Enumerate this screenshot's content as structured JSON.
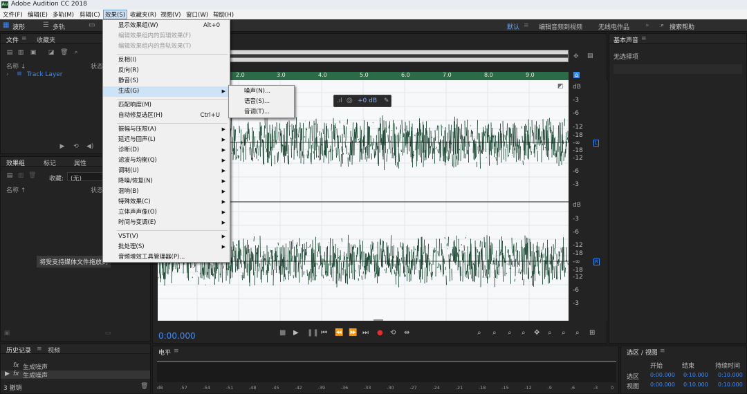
{
  "app": {
    "logo": "Au",
    "title": "Adobe Audition CC 2018"
  },
  "menubar": [
    "文件(F)",
    "编辑(E)",
    "多轨(M)",
    "剪辑(C)",
    "效果(S)",
    "收藏夹(R)",
    "视图(V)",
    "窗口(W)",
    "帮助(H)"
  ],
  "toolbar": {
    "waveform": "波形",
    "multitrack": "多轨",
    "workspace_default": "默认",
    "workspace_edit": "编辑音频到视频",
    "workspace_radio": "无线电作品",
    "search": "搜索帮助"
  },
  "effects_menu": {
    "items": [
      {
        "label": "显示效果组(W)",
        "shortcut": "Alt+0"
      },
      {
        "label": "编辑效果组内的剪辑效果(F)",
        "disabled": true
      },
      {
        "label": "编辑效果组内的音轨效果(T)",
        "disabled": true
      },
      {
        "label": "反相(I)"
      },
      {
        "label": "反向(R)"
      },
      {
        "label": "静音(S)"
      },
      {
        "label": "生成(G)",
        "submenu": true
      },
      {
        "label": "匹配响度(M)"
      },
      {
        "label": "自动修复选区(H)",
        "shortcut": "Ctrl+U"
      },
      {
        "label": "振幅与压限(A)",
        "submenu": true
      },
      {
        "label": "延迟与回声(L)",
        "submenu": true
      },
      {
        "label": "诊断(D)",
        "submenu": true
      },
      {
        "label": "滤波与均衡(Q)",
        "submenu": true
      },
      {
        "label": "调制(U)",
        "submenu": true
      },
      {
        "label": "降噪/恢复(N)",
        "submenu": true
      },
      {
        "label": "混响(B)",
        "submenu": true
      },
      {
        "label": "特殊效果(C)",
        "submenu": true
      },
      {
        "label": "立体声声像(O)",
        "submenu": true
      },
      {
        "label": "时间与变调(E)",
        "submenu": true
      },
      {
        "label": "VST(V)",
        "submenu": true
      },
      {
        "label": "批处理(S)",
        "submenu": true
      },
      {
        "label": "音频增效工具管理器(P)..."
      }
    ],
    "generate_submenu": [
      "噪声(N)...",
      "语音(S)...",
      "音调(T)..."
    ]
  },
  "files_panel": {
    "tab_files": "文件",
    "tab_favorites": "收藏夹",
    "col_name": "名称 ↓",
    "col_status": "状态",
    "file_item": "Track Layer"
  },
  "effects_rack": {
    "tab_rack": "效果组",
    "tab_markers": "标记",
    "tab_properties": "属性",
    "presets_label": "收藏:",
    "presets_value": "(无)",
    "col_name": "名称 ↑",
    "col_status": "状态",
    "drop_hint": "将受支持媒体文件拖放到"
  },
  "editor": {
    "ruler_ticks": [
      "2.0",
      "3.0",
      "4.0",
      "5.0",
      "6.0",
      "7.0",
      "8.0",
      "9.0"
    ],
    "db_unit": "dB",
    "db_top": [
      "-3",
      "-6",
      "-12",
      "-18",
      "-∞",
      "-18",
      "-12",
      "-6",
      "-3"
    ],
    "db_bottom": [
      "-3",
      "-6",
      "-12",
      "-18",
      "-∞",
      "-18",
      "-12",
      "-6",
      "-3"
    ],
    "channel_left": "L",
    "channel_right": "R",
    "hud_value": "+0 dB",
    "time": "0:00.000"
  },
  "level_panel": {
    "title": "电平",
    "scale": [
      "dB",
      "-57",
      "-54",
      "-51",
      "-48",
      "-45",
      "-42",
      "-39",
      "-36",
      "-33",
      "-30",
      "-27",
      "-24",
      "-21",
      "-18",
      "-15",
      "-12",
      "-9",
      "-6",
      "-3",
      "0"
    ]
  },
  "history_panel": {
    "tab_history": "历史记录",
    "tab_video": "视频",
    "items": [
      "生成噪声",
      "生成噪声"
    ],
    "count": "3 撤销"
  },
  "essential_sound": {
    "title": "基本声音",
    "no_selection": "无选择项"
  },
  "selection_view": {
    "title": "选区 / 视图",
    "col_start": "开始",
    "col_end": "结束",
    "col_duration": "持续时间",
    "row_selection": "选区",
    "row_view": "视图",
    "sel_start": "0:00.000",
    "sel_end": "0:10.000",
    "sel_dur": "0:10.000",
    "view_start": "0:00.000",
    "view_end": "0:10.000",
    "view_dur": "0:10.000"
  },
  "colors": {
    "accent": "#2f8bff",
    "waveform": "#1f4a36",
    "ruler": "#2c6b47",
    "record": "#e03030"
  }
}
